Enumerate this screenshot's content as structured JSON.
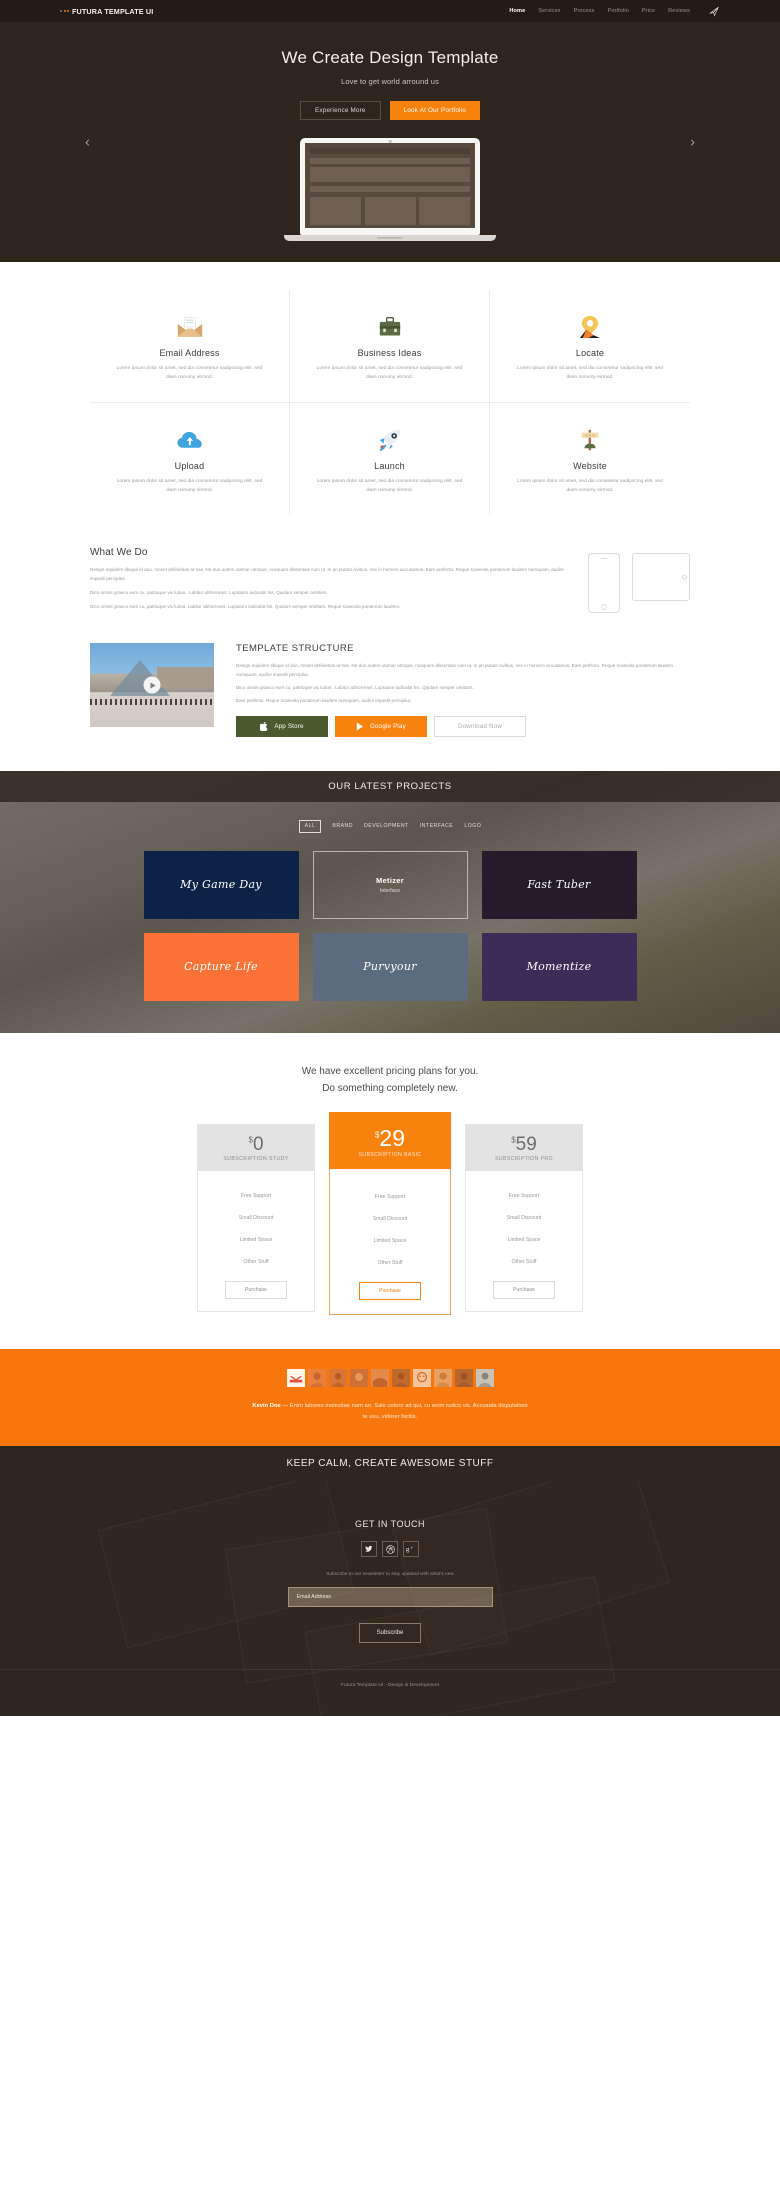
{
  "navbar": {
    "brand": "FUTURA TEMPLATE UI",
    "links": [
      {
        "label": "Home",
        "active": true
      },
      {
        "label": "Services",
        "active": false
      },
      {
        "label": "Process",
        "active": false
      },
      {
        "label": "Portfolio",
        "active": false
      },
      {
        "label": "Price",
        "active": false
      },
      {
        "label": "Reviews",
        "active": false
      }
    ],
    "plane_icon": "paper-plane-icon"
  },
  "hero": {
    "title": "We Create Design Template",
    "subtitle": "Love to get world arround us",
    "primary_btn": "Look At Our Portfolio",
    "secondary_btn": "Experience More",
    "prev_arrow": "‹",
    "next_arrow": "›"
  },
  "features": [
    {
      "icon": "envelope-icon",
      "title": "Email Address",
      "text": "Lorem ipsum dolor sit amet, sed dia consetetur sadipscing elitr, sed diam nonumy eirmod."
    },
    {
      "icon": "briefcase-icon",
      "title": "Business Ideas",
      "text": "Lorem ipsum dolor sit amet, sed dia consetetur sadipscing elitr, sed diam nonumy eirmod."
    },
    {
      "icon": "location-pin-icon",
      "title": "Locate",
      "text": "Lorem ipsum dolor sit amet, sed dia consetetur sadipscing elitr, sed diam nonumy eirmod."
    },
    {
      "icon": "cloud-upload-icon",
      "title": "Upload",
      "text": "Lorem ipsum dolor sit amet, sed dia consetetur sadipscing elitr, sed diam nonumy eirmod."
    },
    {
      "icon": "rocket-icon",
      "title": "Launch",
      "text": "Lorem ipsum dolor sit amet, sed dia consetetur sadipscing elitr, sed diam nonumy eirmod."
    },
    {
      "icon": "signpost-icon",
      "title": "Website",
      "text": "Lorem ipsum dolor sit amet, sed dia consetetur sadipscing elitr, sed diam nonumy eirmod."
    }
  ],
  "whatwedo": {
    "title": "What We Do",
    "p1": "Design equidem tibique id duo, movet definiebas at has. Ne duo autem utamur utroque, nusquam dissentias cum ut. In pri putant civibus, nec in homero accusamus. Eam perfecto. Reque scaevola ponderum laudem numquam, audire impedit percipitur.",
    "p2": "Dico omnis graeco eum cu, patrioque vix ludus . Labitur abhorreant. Luptatum iudicabit his. Quidam semper omittam.",
    "p3": "Dico omnis graeco eum cu, patrioque vix ludus. Labitur abhorreant. Luptatum iudicabit his. Quidam semper omittam. Reque scaevola ponderum laudem."
  },
  "template_structure": {
    "title": "TEMPLATE STRUCTURE",
    "p1": "Design equidem tibique id duo, movet definiebas at has. Ne duo autem utamur utroque, nusquam dissentias cum ut. In pri putant civibus, nec in homero accusamus. Eam perfecto. Reque scaevola ponderum laudem numquam, audire impedit percipitur.",
    "p2": "Dico omnis graeco eum cu, patrioque vix ludus . Labitur abhorreant. Luptatum iudicabit his. Quidam semper omittam.",
    "p3": "Eam perfecto. Reque scaevola ponderum laudem numquam, audire impedit percipitur.",
    "btn_apple": "App Store",
    "btn_play": "Google Play",
    "btn_download": "Download Now"
  },
  "projects": {
    "heading": "OUR LATEST PROJECTS",
    "filters": [
      {
        "label": "ALL",
        "active": true
      },
      {
        "label": "BRAND",
        "active": false
      },
      {
        "label": "DEVELOPMENT",
        "active": false
      },
      {
        "label": "INTERFACE",
        "active": false
      },
      {
        "label": "LOGO",
        "active": false
      }
    ],
    "items": [
      {
        "title": "My Game Day",
        "subtitle": "",
        "style": "navy",
        "script": true
      },
      {
        "title": "Metizer",
        "subtitle": "Interface",
        "style": "clear",
        "script": false
      },
      {
        "title": "Fast Tuber",
        "subtitle": "",
        "style": "dkpurple",
        "script": true
      },
      {
        "title": "Capture Life",
        "subtitle": "",
        "style": "orange",
        "script": true
      },
      {
        "title": "Purvyour",
        "subtitle": "",
        "style": "slate",
        "script": true
      },
      {
        "title": "Momentize",
        "subtitle": "",
        "style": "purple",
        "script": true
      }
    ]
  },
  "pricing": {
    "lead_line1": "We have excellent pricing plans for you.",
    "lead_line2": "Do something completely new.",
    "plans": [
      {
        "currency": "$",
        "amount": "0",
        "label": "SUBSCRIPTION STUDY",
        "featured": false,
        "features": [
          "Free Support",
          "Small Discount",
          "Limited Space",
          "Other Stuff"
        ],
        "cta": "Purchase"
      },
      {
        "currency": "$",
        "amount": "29",
        "label": "SUBSCRIPTION BASIC",
        "featured": true,
        "features": [
          "Free Support",
          "Small Discount",
          "Limited Space",
          "Other Stuff"
        ],
        "cta": "Purchase"
      },
      {
        "currency": "$",
        "amount": "59",
        "label": "SUBSCRIPTION PRO",
        "featured": false,
        "features": [
          "Free Support",
          "Small Discount",
          "Limited Space",
          "Other Stuff"
        ],
        "cta": "Purchase"
      }
    ]
  },
  "testimonial": {
    "author": "Kevin Doe",
    "dash": " — ",
    "quote": "Enim labores molestiae nam an. Sale cetero ad qui, cu enim iudico vix. Accusata disputationi te usu, viderer facilis.",
    "avatar_count": 10
  },
  "keepcalm": {
    "heading": "KEEP CALM, CREATE AWESOME STUFF"
  },
  "getintouch": {
    "heading": "GET IN TOUCH",
    "socials": [
      {
        "name": "twitter-icon",
        "glyph": "ᵛ"
      },
      {
        "name": "dribbble-icon",
        "glyph": "◎"
      },
      {
        "name": "google-plus-icon",
        "glyph": "g⁺"
      }
    ],
    "note": "Subscribe to our newsletter to stay updated with what's new",
    "email_placeholder": "Email Address",
    "email_value": "",
    "subscribe_btn": "Subscribe"
  },
  "footer": {
    "text": "Futura Template UI - Design & Development"
  },
  "colors": {
    "brand_orange": "#f7820e",
    "testimonial_orange": "#f7770d",
    "dark_brown": "#2e251d",
    "navbar_dark": "#231c16"
  }
}
